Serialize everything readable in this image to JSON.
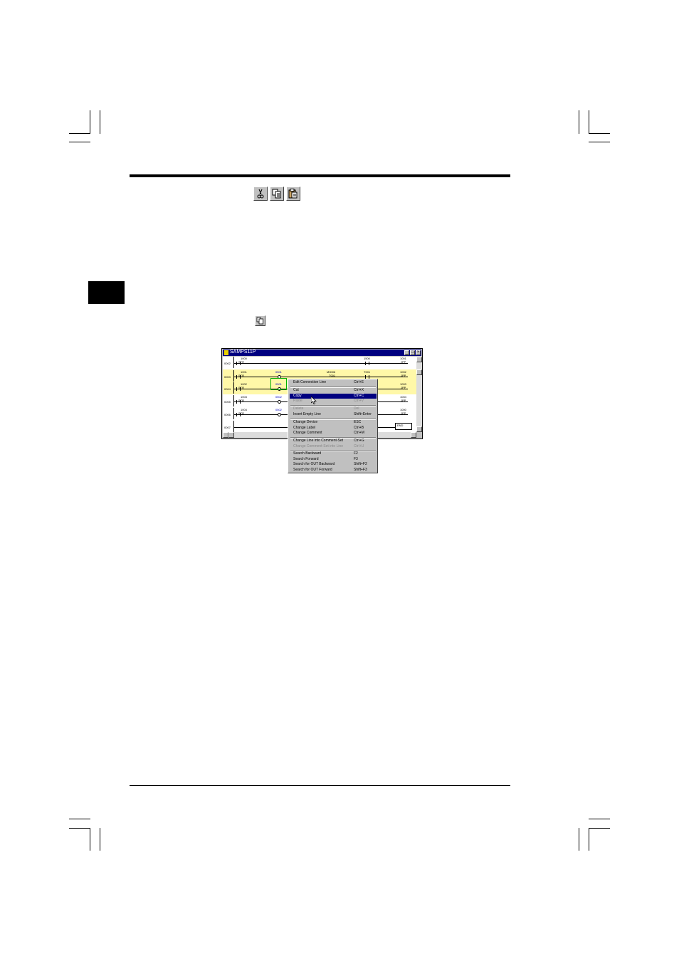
{
  "toolbar_icons": [
    "cut-icon",
    "copy-icon",
    "paste-icon"
  ],
  "small_icon": "copy-icon",
  "window": {
    "title": "SAMPS11P",
    "controls": [
      "_",
      "□",
      "×"
    ]
  },
  "rungs": [
    {
      "num": "0002",
      "d1": "1000",
      "d1b": "STR",
      "d2": "1500",
      "d3": "1001",
      "d3b": "JPP"
    },
    {
      "num": "0003",
      "d1": "1001",
      "d1b": "STR",
      "d2": "0501",
      "d4": "M0006",
      "d4b": "T001",
      "d5": "T001",
      "d3": "1002",
      "d3b": "JPP"
    },
    {
      "num": "0004",
      "d1": "1002",
      "d1b": "STR",
      "d2": "0501",
      "d3": "1003",
      "d3b": "JPP"
    },
    {
      "num": "0005",
      "d1": "1003",
      "d1b": "STR",
      "d2": "0502",
      "d3": "1004",
      "d3b": "JPP"
    },
    {
      "num": "0006",
      "d1": "1004",
      "d1b": "STR",
      "d2": "0502",
      "d3": "1000",
      "d3b": "JPP"
    },
    {
      "num": "0007",
      "d3": "END"
    }
  ],
  "context_menu": [
    {
      "label": "Edit Connection Line",
      "shortcut": "Ctrl+E",
      "state": "normal"
    },
    {
      "sep": true
    },
    {
      "label": "Cut",
      "shortcut": "Ctrl+X",
      "state": "normal"
    },
    {
      "label": "Copy",
      "shortcut": "Ctrl+C",
      "state": "highlight"
    },
    {
      "label": "Paste",
      "shortcut": "Ctrl+V",
      "state": "disabled"
    },
    {
      "sep": true
    },
    {
      "label": "Delete",
      "shortcut": "Del",
      "state": "disabled"
    },
    {
      "label": "Insert Empty Line",
      "shortcut": "Shift+Enter",
      "state": "normal"
    },
    {
      "sep": true
    },
    {
      "label": "Change Device",
      "shortcut": "ESC",
      "state": "normal"
    },
    {
      "label": "Change Label",
      "shortcut": "Ctrl+B",
      "state": "normal"
    },
    {
      "label": "Change Comment",
      "shortcut": "Ctrl+M",
      "state": "normal"
    },
    {
      "sep": true
    },
    {
      "label": "Change Line into Comment-Set",
      "shortcut": "Ctrl+G",
      "state": "normal"
    },
    {
      "label": "Change Comment-Set into Line",
      "shortcut": "Ctrl+U",
      "state": "disabled"
    },
    {
      "sep": true
    },
    {
      "label": "Search Backward",
      "shortcut": "F2",
      "state": "normal"
    },
    {
      "label": "Search Forward",
      "shortcut": "F3",
      "state": "normal"
    },
    {
      "label": "Search for OUT Backward",
      "shortcut": "Shift+F2",
      "state": "normal"
    },
    {
      "label": "Search for OUT Forward",
      "shortcut": "Shift+F3",
      "state": "normal"
    }
  ]
}
